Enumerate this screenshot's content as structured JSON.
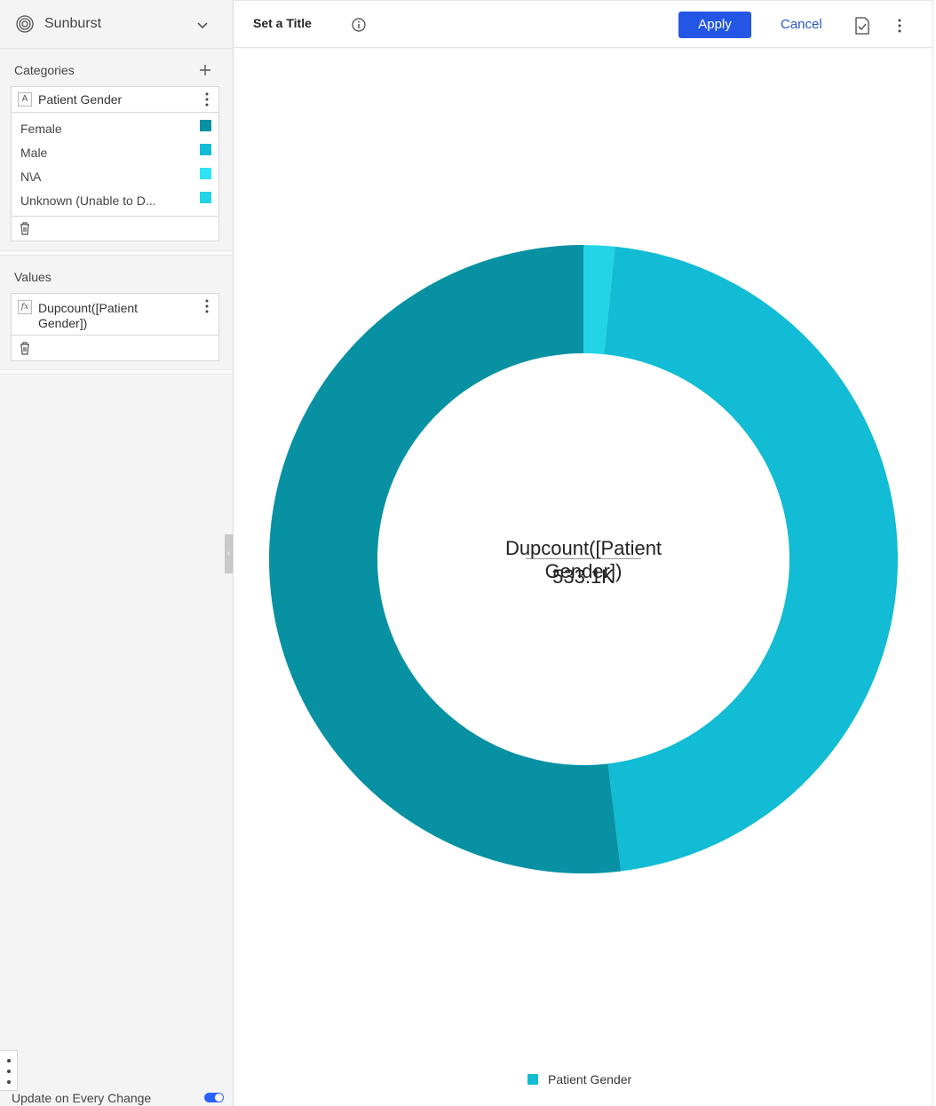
{
  "sidebar": {
    "visualization": {
      "label": "Sunburst",
      "icon": "sunburst-icon"
    },
    "categories": {
      "label": "Categories",
      "field": {
        "type_badge": "A",
        "name": "Patient Gender"
      },
      "items": [
        {
          "label": "Female",
          "color": "#0791a3"
        },
        {
          "label": "Male",
          "color": "#11bcd4"
        },
        {
          "label": "N\\A",
          "color": "#2ee3f5"
        },
        {
          "label": "Unknown (Unable to D...",
          "color": "#22d4e6"
        }
      ]
    },
    "values": {
      "label": "Values",
      "field": {
        "type_badge": "fx",
        "name": "Dupcount([Patient Gender])"
      }
    },
    "footer": {
      "update_label": "Update on Every Change",
      "update_enabled": true
    }
  },
  "toolbar": {
    "title": "Set a Title",
    "apply_label": "Apply",
    "cancel_label": "Cancel"
  },
  "chart_data": {
    "type": "pie",
    "subtype": "donut",
    "center_label": "Dupcount([Patient Gender])",
    "center_value": "533.1K",
    "categories": [
      "Female",
      "Male",
      "N\\A",
      "Unknown (Unable to D..."
    ],
    "values": [
      0.519,
      0.465,
      0.016,
      0.0
    ],
    "colors": [
      "#0791a3",
      "#11bcd4",
      "#22d4e6",
      "#2ee3f5"
    ],
    "legend": [
      {
        "label": "Patient Gender",
        "color": "#11bcd4"
      }
    ],
    "legend_position": "bottom"
  }
}
